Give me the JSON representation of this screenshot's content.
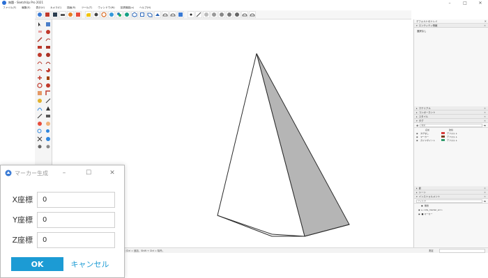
{
  "window": {
    "title": "無題 - SketchUp Pro 2021"
  },
  "menubar": {
    "items": [
      "ファイル(F)",
      "編集(E)",
      "表示(V)",
      "カメラ(C)",
      "描画(R)",
      "ツール(T)",
      "ウィンドウ(W)",
      "拡張機能(x)",
      "ヘルプ(H)"
    ]
  },
  "tray": {
    "title": "デフォルトのトレイ",
    "entity_info": {
      "header": "エンティティ情報",
      "body": "選択なし"
    },
    "panels_mid": [
      "マテリアル",
      "コンポーネント",
      "スタイル",
      "タグ"
    ],
    "tags": {
      "search_placeholder": "検索",
      "col_name": "名前",
      "col_dash": "破線",
      "rows": [
        {
          "name": "タグなし",
          "color": "#d83a3a",
          "dash": "デフォルト"
        },
        {
          "name": "マーカー",
          "color": "#7a3b1f",
          "dash": "デフォルト"
        },
        {
          "name": "ガイドポイント",
          "color": "#2e9a6a",
          "dash": "デフォルト"
        }
      ]
    },
    "panels_low": [
      "影",
      "シーン",
      "インストゥルメント"
    ],
    "outliner": {
      "search_placeholder": "フィルタ",
      "root": "無題",
      "items": [
        "<ide_marker_src>",
        "マーカー"
      ]
    }
  },
  "statusbar": {
    "text": "選択: Ctrl = 追加、Shift + Ctrl = 除外。",
    "measure_label": "測定"
  },
  "dialog": {
    "title": "マーカー生成",
    "fields": [
      {
        "label": "X座標",
        "value": "0"
      },
      {
        "label": "Y座標",
        "value": "0"
      },
      {
        "label": "Z座標",
        "value": "0"
      }
    ],
    "ok_label": "OK",
    "cancel_label": "キャンセル"
  },
  "colors": {
    "accent": "#1c9bd4"
  }
}
